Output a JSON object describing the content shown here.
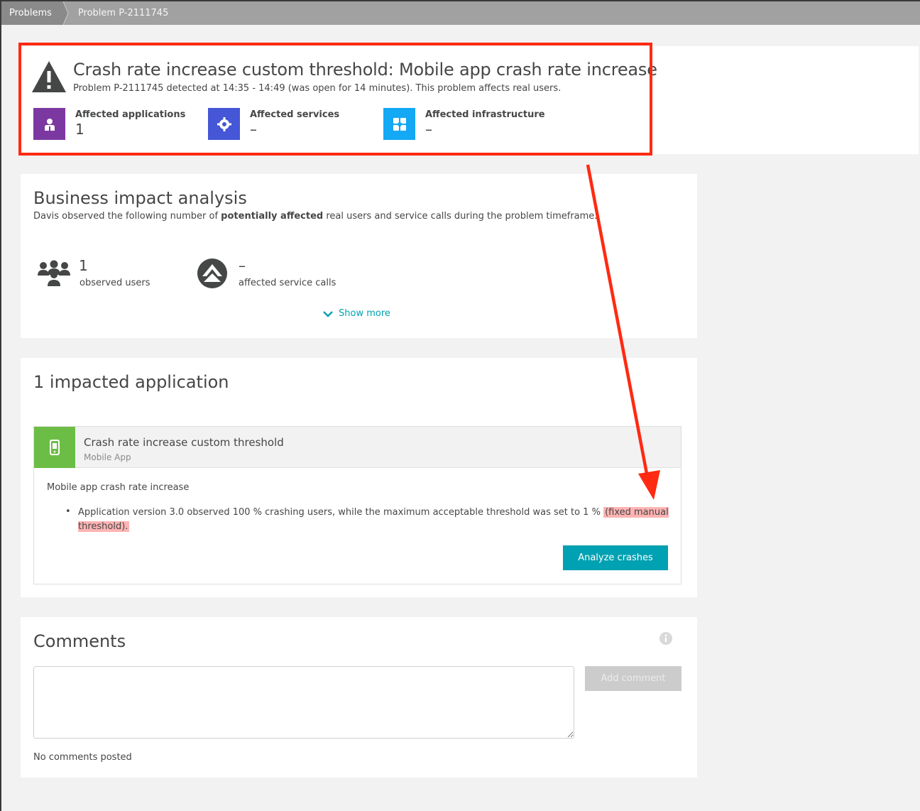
{
  "breadcrumb": {
    "root": "Problems",
    "current": "Problem P-2111745"
  },
  "problem": {
    "title": "Crash rate increase custom threshold: Mobile app crash rate increase",
    "subtitle": "Problem P-2111745 detected at 14:35 - 14:49 (was open for 14 minutes). This problem affects real users."
  },
  "affected": [
    {
      "label": "Affected applications",
      "value": "1",
      "color": "#7c38a1",
      "icon": "user-icon"
    },
    {
      "label": "Affected services",
      "value": "–",
      "color": "#4556d7",
      "icon": "gear-icon"
    },
    {
      "label": "Affected infrastructure",
      "value": "–",
      "color": "#14a8f5",
      "icon": "infrastructure-icon"
    }
  ],
  "business_impact": {
    "title": "Business impact analysis",
    "desc_prefix": "Davis observed the following number of ",
    "desc_bold": "potentially affected",
    "desc_suffix": " real users and service calls during the problem timeframe.",
    "users_value": "1",
    "users_label": "observed users",
    "calls_value": "–",
    "calls_label": "affected service calls",
    "show_more": "Show more"
  },
  "impacted": {
    "title": "1 impacted application",
    "app_name": "Crash rate increase custom threshold",
    "app_type": "Mobile App",
    "event_title": "Mobile app crash rate increase",
    "event_text": "Application version 3.0 observed 100 % crashing users, while the maximum acceptable threshold was set to 1 % ",
    "event_highlight": "(fixed manual threshold).",
    "button": "Analyze crashes",
    "app_color": "#6cbd45",
    "button_color": "#00a1b2"
  },
  "comments": {
    "title": "Comments",
    "add_button": "Add comment",
    "empty": "No comments posted"
  },
  "annotation_color": "#ff2a12"
}
